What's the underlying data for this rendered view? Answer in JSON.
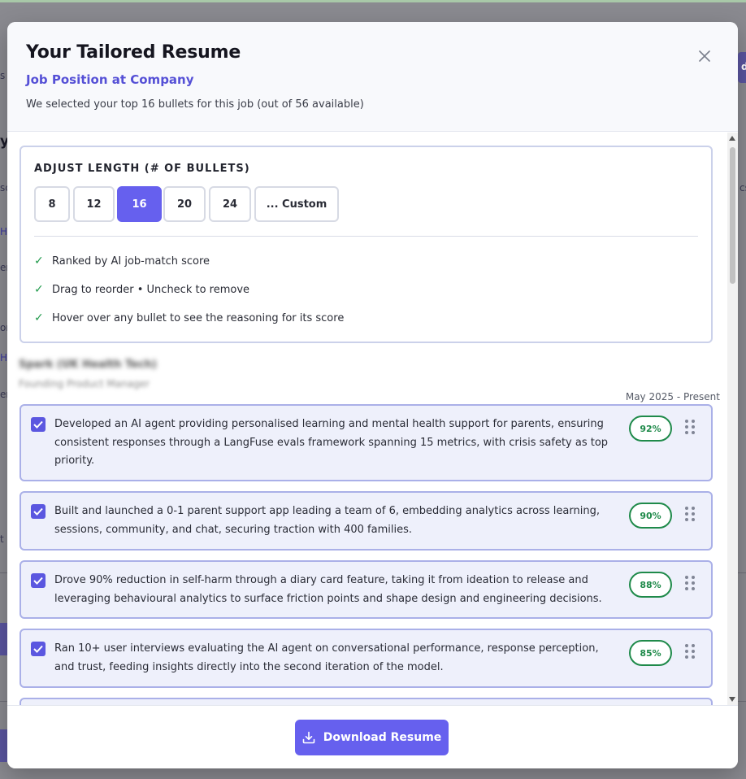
{
  "background": {
    "fragments": [
      "s",
      "y",
      "sc",
      "H",
      "er",
      "or",
      "H",
      "er",
      "t",
      "cs"
    ],
    "button_fragment": "d"
  },
  "modal": {
    "title": "Your Tailored Resume",
    "subtitle": "Job Position at Company",
    "note": "We selected your top 16 bullets for this job (out of 56 available)",
    "close_icon": "close-icon"
  },
  "adjust": {
    "title": "ADJUST LENGTH (# OF BULLETS)",
    "options": [
      "8",
      "12",
      "16",
      "20",
      "24",
      "... Custom"
    ],
    "selected": "16",
    "features": [
      "Ranked by AI job-match score",
      "Drag to reorder • Uncheck to remove",
      "Hover over any bullet to see the reasoning for its score"
    ]
  },
  "experience": {
    "company": "Spark (UK Health Tech)",
    "role": "Founding Product Manager",
    "dates": "May 2025 - Present",
    "bullets": [
      {
        "text": "Developed an AI agent providing personalised learning and mental health support for parents, ensuring consistent responses through a LangFuse evals framework spanning 15 metrics, with crisis safety as top priority.",
        "score": "92%",
        "checked": true
      },
      {
        "text": "Built and launched a 0-1 parent support app leading a team of 6, embedding analytics across learning, sessions, community, and chat, securing traction with 400 families.",
        "score": "90%",
        "checked": true
      },
      {
        "text": "Drove 90% reduction in self-harm through a diary card feature, taking it from ideation to release and leveraging behavioural analytics to surface friction points and shape design and engineering decisions.",
        "score": "88%",
        "checked": true
      },
      {
        "text": "Ran 10+ user interviews evaluating the AI agent on conversational performance, response perception, and trust, feeding insights directly into the second iteration of the model.",
        "score": "85%",
        "checked": true
      }
    ]
  },
  "footer": {
    "download_label": "Download Resume"
  },
  "colors": {
    "accent": "#6660ee",
    "subtitle": "#5550d6",
    "score_green": "#1f8a4a",
    "check_green": "#1f9a4b",
    "bullet_bg": "#eef0fb",
    "bullet_border": "#aab0e8"
  }
}
